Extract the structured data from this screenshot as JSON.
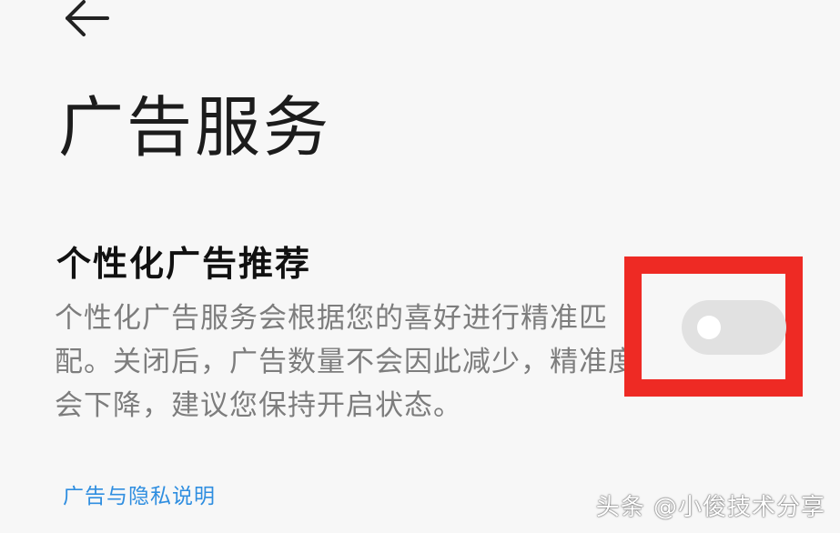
{
  "header": {
    "back_icon": "arrow-left-icon"
  },
  "page": {
    "title": "广告服务"
  },
  "setting": {
    "title": "个性化广告推荐",
    "description": "个性化广告服务会根据您的喜好进行精准匹配。关闭后，广告数量不会因此减少，精准度会下降，建议您保持开启状态。",
    "toggle_state": "off"
  },
  "links": {
    "privacy": "广告与隐私说明"
  },
  "watermark": {
    "text": "头条 @小俊技术分享"
  },
  "colors": {
    "highlight": "#ee2a24",
    "link": "#2f8ee0",
    "toggle_track": "#e1e1e1"
  }
}
